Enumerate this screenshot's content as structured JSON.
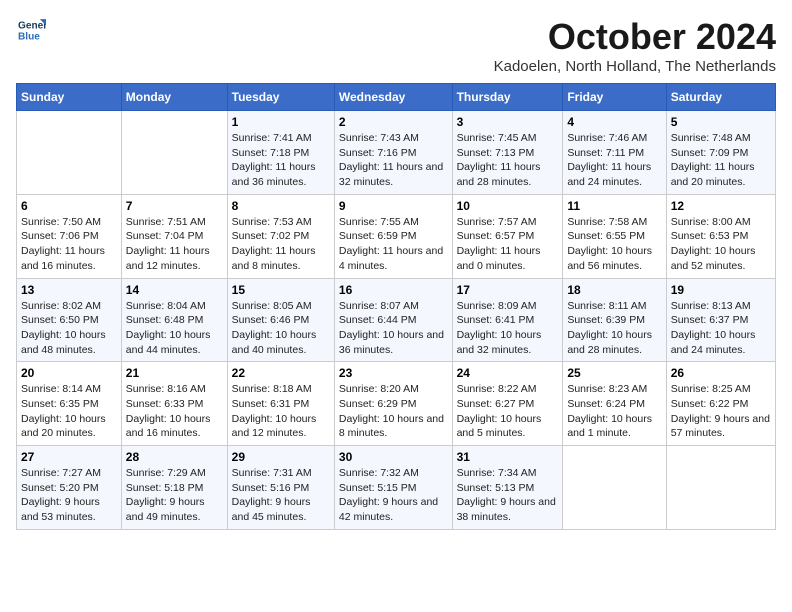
{
  "header": {
    "logo": {
      "line1": "General",
      "line2": "Blue"
    },
    "title": "October 2024",
    "location": "Kadoelen, North Holland, The Netherlands"
  },
  "days_of_week": [
    "Sunday",
    "Monday",
    "Tuesday",
    "Wednesday",
    "Thursday",
    "Friday",
    "Saturday"
  ],
  "weeks": [
    [
      {
        "day": "",
        "sunrise": "",
        "sunset": "",
        "daylight": ""
      },
      {
        "day": "",
        "sunrise": "",
        "sunset": "",
        "daylight": ""
      },
      {
        "day": "1",
        "sunrise": "Sunrise: 7:41 AM",
        "sunset": "Sunset: 7:18 PM",
        "daylight": "Daylight: 11 hours and 36 minutes."
      },
      {
        "day": "2",
        "sunrise": "Sunrise: 7:43 AM",
        "sunset": "Sunset: 7:16 PM",
        "daylight": "Daylight: 11 hours and 32 minutes."
      },
      {
        "day": "3",
        "sunrise": "Sunrise: 7:45 AM",
        "sunset": "Sunset: 7:13 PM",
        "daylight": "Daylight: 11 hours and 28 minutes."
      },
      {
        "day": "4",
        "sunrise": "Sunrise: 7:46 AM",
        "sunset": "Sunset: 7:11 PM",
        "daylight": "Daylight: 11 hours and 24 minutes."
      },
      {
        "day": "5",
        "sunrise": "Sunrise: 7:48 AM",
        "sunset": "Sunset: 7:09 PM",
        "daylight": "Daylight: 11 hours and 20 minutes."
      }
    ],
    [
      {
        "day": "6",
        "sunrise": "Sunrise: 7:50 AM",
        "sunset": "Sunset: 7:06 PM",
        "daylight": "Daylight: 11 hours and 16 minutes."
      },
      {
        "day": "7",
        "sunrise": "Sunrise: 7:51 AM",
        "sunset": "Sunset: 7:04 PM",
        "daylight": "Daylight: 11 hours and 12 minutes."
      },
      {
        "day": "8",
        "sunrise": "Sunrise: 7:53 AM",
        "sunset": "Sunset: 7:02 PM",
        "daylight": "Daylight: 11 hours and 8 minutes."
      },
      {
        "day": "9",
        "sunrise": "Sunrise: 7:55 AM",
        "sunset": "Sunset: 6:59 PM",
        "daylight": "Daylight: 11 hours and 4 minutes."
      },
      {
        "day": "10",
        "sunrise": "Sunrise: 7:57 AM",
        "sunset": "Sunset: 6:57 PM",
        "daylight": "Daylight: 11 hours and 0 minutes."
      },
      {
        "day": "11",
        "sunrise": "Sunrise: 7:58 AM",
        "sunset": "Sunset: 6:55 PM",
        "daylight": "Daylight: 10 hours and 56 minutes."
      },
      {
        "day": "12",
        "sunrise": "Sunrise: 8:00 AM",
        "sunset": "Sunset: 6:53 PM",
        "daylight": "Daylight: 10 hours and 52 minutes."
      }
    ],
    [
      {
        "day": "13",
        "sunrise": "Sunrise: 8:02 AM",
        "sunset": "Sunset: 6:50 PM",
        "daylight": "Daylight: 10 hours and 48 minutes."
      },
      {
        "day": "14",
        "sunrise": "Sunrise: 8:04 AM",
        "sunset": "Sunset: 6:48 PM",
        "daylight": "Daylight: 10 hours and 44 minutes."
      },
      {
        "day": "15",
        "sunrise": "Sunrise: 8:05 AM",
        "sunset": "Sunset: 6:46 PM",
        "daylight": "Daylight: 10 hours and 40 minutes."
      },
      {
        "day": "16",
        "sunrise": "Sunrise: 8:07 AM",
        "sunset": "Sunset: 6:44 PM",
        "daylight": "Daylight: 10 hours and 36 minutes."
      },
      {
        "day": "17",
        "sunrise": "Sunrise: 8:09 AM",
        "sunset": "Sunset: 6:41 PM",
        "daylight": "Daylight: 10 hours and 32 minutes."
      },
      {
        "day": "18",
        "sunrise": "Sunrise: 8:11 AM",
        "sunset": "Sunset: 6:39 PM",
        "daylight": "Daylight: 10 hours and 28 minutes."
      },
      {
        "day": "19",
        "sunrise": "Sunrise: 8:13 AM",
        "sunset": "Sunset: 6:37 PM",
        "daylight": "Daylight: 10 hours and 24 minutes."
      }
    ],
    [
      {
        "day": "20",
        "sunrise": "Sunrise: 8:14 AM",
        "sunset": "Sunset: 6:35 PM",
        "daylight": "Daylight: 10 hours and 20 minutes."
      },
      {
        "day": "21",
        "sunrise": "Sunrise: 8:16 AM",
        "sunset": "Sunset: 6:33 PM",
        "daylight": "Daylight: 10 hours and 16 minutes."
      },
      {
        "day": "22",
        "sunrise": "Sunrise: 8:18 AM",
        "sunset": "Sunset: 6:31 PM",
        "daylight": "Daylight: 10 hours and 12 minutes."
      },
      {
        "day": "23",
        "sunrise": "Sunrise: 8:20 AM",
        "sunset": "Sunset: 6:29 PM",
        "daylight": "Daylight: 10 hours and 8 minutes."
      },
      {
        "day": "24",
        "sunrise": "Sunrise: 8:22 AM",
        "sunset": "Sunset: 6:27 PM",
        "daylight": "Daylight: 10 hours and 5 minutes."
      },
      {
        "day": "25",
        "sunrise": "Sunrise: 8:23 AM",
        "sunset": "Sunset: 6:24 PM",
        "daylight": "Daylight: 10 hours and 1 minute."
      },
      {
        "day": "26",
        "sunrise": "Sunrise: 8:25 AM",
        "sunset": "Sunset: 6:22 PM",
        "daylight": "Daylight: 9 hours and 57 minutes."
      }
    ],
    [
      {
        "day": "27",
        "sunrise": "Sunrise: 7:27 AM",
        "sunset": "Sunset: 5:20 PM",
        "daylight": "Daylight: 9 hours and 53 minutes."
      },
      {
        "day": "28",
        "sunrise": "Sunrise: 7:29 AM",
        "sunset": "Sunset: 5:18 PM",
        "daylight": "Daylight: 9 hours and 49 minutes."
      },
      {
        "day": "29",
        "sunrise": "Sunrise: 7:31 AM",
        "sunset": "Sunset: 5:16 PM",
        "daylight": "Daylight: 9 hours and 45 minutes."
      },
      {
        "day": "30",
        "sunrise": "Sunrise: 7:32 AM",
        "sunset": "Sunset: 5:15 PM",
        "daylight": "Daylight: 9 hours and 42 minutes."
      },
      {
        "day": "31",
        "sunrise": "Sunrise: 7:34 AM",
        "sunset": "Sunset: 5:13 PM",
        "daylight": "Daylight: 9 hours and 38 minutes."
      },
      {
        "day": "",
        "sunrise": "",
        "sunset": "",
        "daylight": ""
      },
      {
        "day": "",
        "sunrise": "",
        "sunset": "",
        "daylight": ""
      }
    ]
  ]
}
